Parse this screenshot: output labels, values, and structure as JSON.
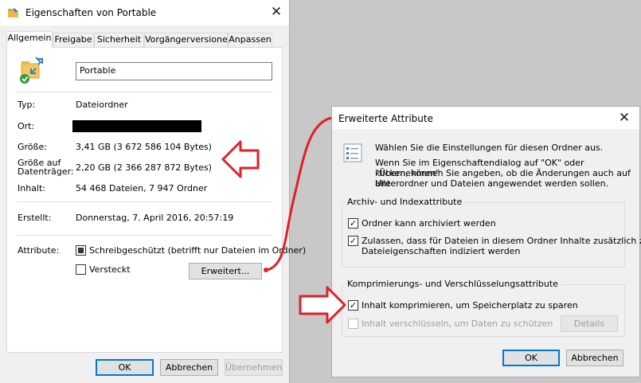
{
  "props_dialog": {
    "title": "Eigenschaften von Portable",
    "tabs": [
      "Allgemein",
      "Freigabe",
      "Sicherheit",
      "Vorgängerversionen",
      "Anpassen"
    ],
    "folder_name": "Portable",
    "rows": {
      "typ_label": "Typ:",
      "typ_value": "Dateiordner",
      "ort_label": "Ort:",
      "groesse_label": "Größe:",
      "groesse_value": "3,41 GB (3 672 586 104 Bytes)",
      "groesse_auf_label_1": "Größe auf",
      "groesse_auf_label_2": "Datenträger:",
      "groesse_auf_value": "2,20 GB (2 366 287 872 Bytes)",
      "inhalt_label": "Inhalt:",
      "inhalt_value": "54 468 Dateien, 7 947 Ordner",
      "erstellt_label": "Erstellt:",
      "erstellt_value": "Donnerstag, 7. April 2016, 20:57:19",
      "attribute_label": "Attribute:"
    },
    "attributes": {
      "readonly_label": "Schreibgeschützt (betrifft nur Dateien im Ordner)",
      "hidden_label": "Versteckt",
      "advanced_button": "Erweitert..."
    },
    "buttons": {
      "ok": "OK",
      "cancel": "Abbrechen",
      "apply": "Übernehmen"
    }
  },
  "adv_dialog": {
    "title": "Erweiterte Attribute",
    "intro_1": "Wählen Sie die Einstellungen für diesen Ordner aus.",
    "intro_2_line1": "Wenn Sie im Eigenschaftendialog auf \"OK\" oder \"Übernehmen\"",
    "intro_2_line2": "klicken, können Sie angeben, ob die Änderungen auch auf alle",
    "intro_2_line3": "Unterordner und Dateien angewendet werden sollen.",
    "archive_group": {
      "title": "Archiv- und Indexattribute",
      "archive_label": "Ordner kann archiviert werden",
      "index_label_line1": "Zulassen, dass für Dateien in diesem Ordner Inhalte zusätzlich zu",
      "index_label_line2": "Dateieigenschaften indiziert werden"
    },
    "compress_group": {
      "title": "Komprimierungs- und Verschlüsselungsattribute",
      "compress_label": "Inhalt komprimieren, um Speicherplatz zu sparen",
      "encrypt_label": "Inhalt verschlüsseln, um Daten zu schützen",
      "details_button": "Details"
    },
    "buttons": {
      "ok": "OK",
      "cancel": "Abbrechen"
    }
  },
  "colors": {
    "annotation_red": "#e0202a",
    "focus_blue": "#0078d7"
  }
}
